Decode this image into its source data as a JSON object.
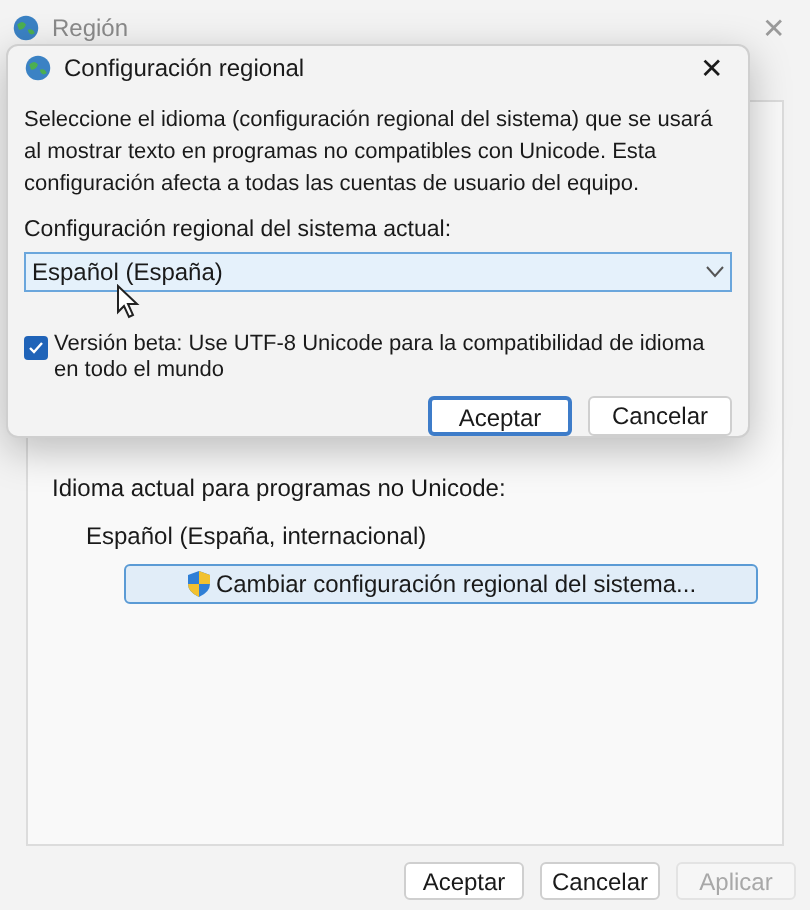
{
  "window": {
    "title": "Región",
    "close": "✕"
  },
  "panel": {
    "label": "Idioma actual para programas no Unicode:",
    "value": "Español (España, internacional)",
    "button": "Cambiar configuración regional del sistema..."
  },
  "buttons": [
    {
      "label": "Aceptar",
      "disabled": false
    },
    {
      "label": "Cancelar",
      "disabled": false
    },
    {
      "label": "Aplicar",
      "disabled": true
    }
  ],
  "dialog": {
    "title": "Configuración regional",
    "close": "✕",
    "description": "Seleccione el idioma (configuración regional del sistema) que se usará al mostrar texto en programas no compatibles con Unicode. Esta configuración afecta a todas las cuentas de usuario del equipo.",
    "select_label": "Configuración regional del sistema actual:",
    "select_value": "Español (España)",
    "checkbox": {
      "label": "Versión beta: Use UTF-8 Unicode para la compatibilidad de idioma en todo el mundo",
      "checked": true
    },
    "buttons": [
      {
        "label": "Aceptar",
        "default": true
      },
      {
        "label": "Cancelar",
        "default": false
      }
    ]
  }
}
